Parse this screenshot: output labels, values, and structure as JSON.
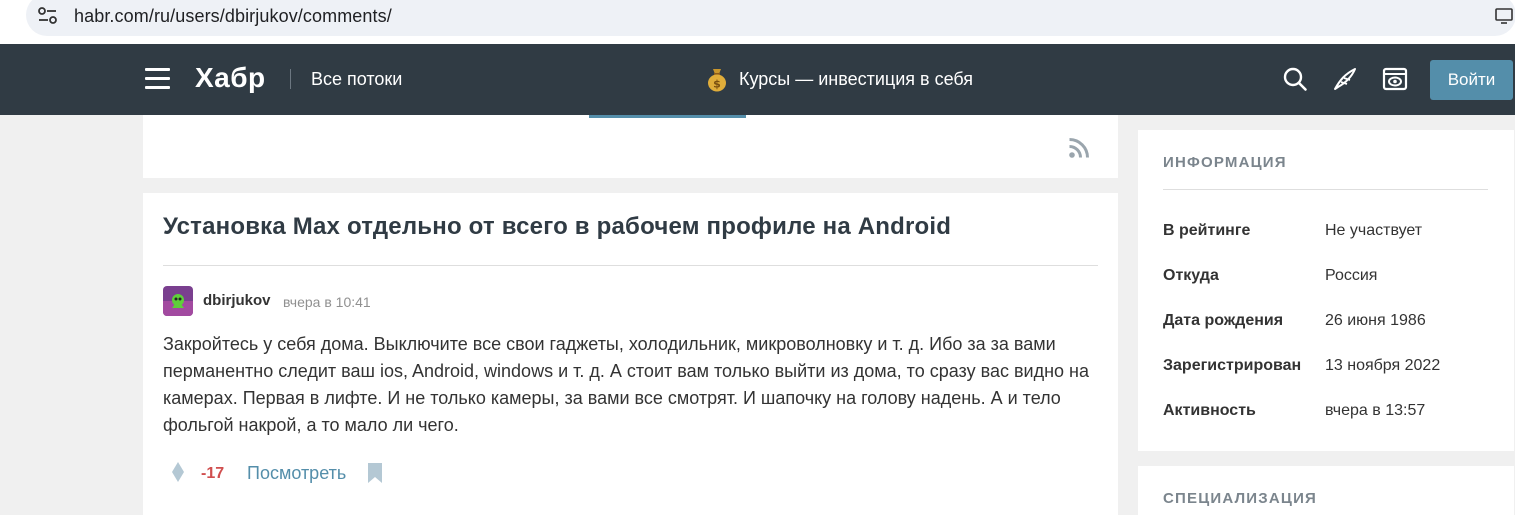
{
  "browser": {
    "url": "habr.com/ru/users/dbirjukov/comments/"
  },
  "header": {
    "logo": "Хабр",
    "all_streams": "Все потоки",
    "promo_text": "Курсы — инвестиция в себя",
    "login_label": "Войти"
  },
  "post": {
    "title": "Установка Max отдельно от всего в рабочем профиле на Android",
    "author": "dbirjukov",
    "time": "вчера в 10:41",
    "text": "Закройтесь у себя дома. Выключите все свои гаджеты, холодильник, микроволновку и т. д. Ибо за за вами перманентно следит ваш ios, Android, windows и т. д. А стоит вам только выйти из дома, то сразу вас видно на камерах. Первая в лифте. И не только камеры, за вами все смотрят. И шапочку на голову надень. А и тело фольгой накрой, а то мало ли чего.",
    "score": "-17",
    "view_label": "Посмотреть"
  },
  "sidebar": {
    "info_heading": "ИНФОРМАЦИЯ",
    "rows": [
      {
        "label": "В рейтинге",
        "value": "Не участвует"
      },
      {
        "label": "Откуда",
        "value": "Россия"
      },
      {
        "label": "Дата рождения",
        "value": "26 июня 1986"
      },
      {
        "label": "Зарегистрирован",
        "value": "13 ноября 2022"
      },
      {
        "label": "Активность",
        "value": "вчера в 13:57"
      }
    ],
    "spec_heading": "СПЕЦИАЛИЗАЦИЯ"
  },
  "colors": {
    "header_bg": "#303b44",
    "accent": "#548eaa",
    "negative_score": "#d04e4e"
  }
}
